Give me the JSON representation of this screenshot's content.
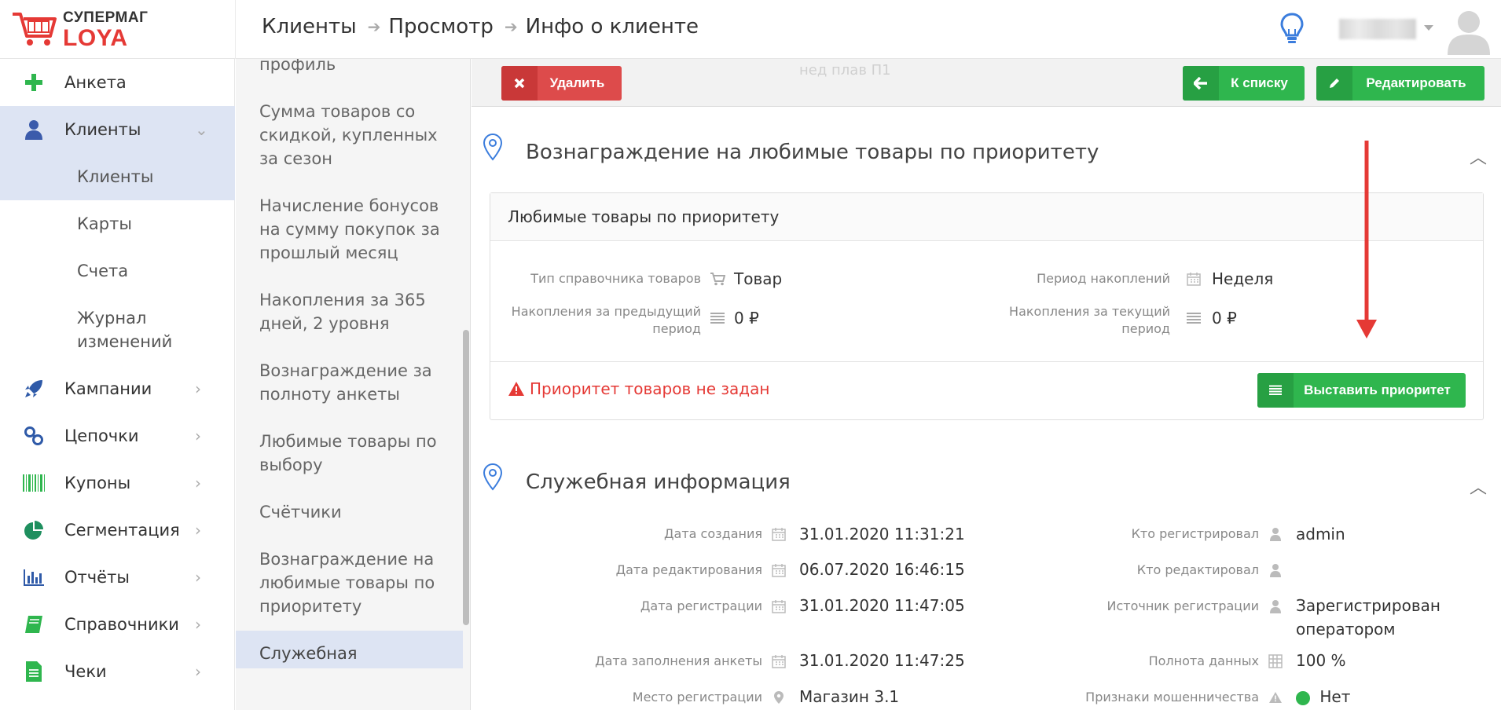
{
  "brand": {
    "top": "СУПЕРМАГ",
    "bottom": "LOYA"
  },
  "breadcrumb": [
    "Клиенты",
    "Просмотр",
    "Инфо о клиенте"
  ],
  "sidebar": {
    "items": [
      {
        "label": "Анкета",
        "icon": "plus-icon"
      },
      {
        "label": "Клиенты",
        "icon": "user-icon"
      },
      {
        "label": "Кампании",
        "icon": "rocket-icon"
      },
      {
        "label": "Цепочки",
        "icon": "chain-icon"
      },
      {
        "label": "Купоны",
        "icon": "barcode-icon"
      },
      {
        "label": "Сегментация",
        "icon": "pie-chart-icon"
      },
      {
        "label": "Отчёты",
        "icon": "bar-chart-icon"
      },
      {
        "label": "Справочники",
        "icon": "book-icon"
      },
      {
        "label": "Чеки",
        "icon": "receipt-icon"
      }
    ],
    "sub": [
      "Клиенты",
      "Карты",
      "Счета",
      "Журнал изменений"
    ]
  },
  "secnav": [
    "профиль",
    "Сумма товаров со скидкой, купленных за сезон",
    "Начисление бонусов на сумму покупок за прошлый месяц",
    "Накопления за 365 дней, 2 уровня",
    "Вознаграждение за полноту анкеты",
    "Любимые товары по выбору",
    "Счётчики",
    "Вознаграждение на любимые товары по приоритету",
    "Служебная"
  ],
  "actions": {
    "delete": "Удалить",
    "to_list": "К списку",
    "edit": "Редактировать",
    "ghost": "нед плав П1"
  },
  "section1": {
    "title": "Вознаграждение на любимые товары по приоритету",
    "panel_title": "Любимые товары по приоритету",
    "fields": {
      "ref_type_label": "Тип справочника товаров",
      "ref_type_value": "Товар",
      "period_label": "Период накоплений",
      "period_value": "Неделя",
      "prev_label": "Накопления за предыдущий период",
      "prev_value": "0 ₽",
      "cur_label": "Накопления за текущий период",
      "cur_value": "0 ₽"
    },
    "warning": "Приоритет товаров не задан",
    "set_priority": "Выставить приоритет"
  },
  "section2": {
    "title": "Служебная информация",
    "created_label": "Дата создания",
    "created_value": "31.01.2020 11:31:21",
    "edited_label": "Дата редактирования",
    "edited_value": "06.07.2020 16:46:15",
    "registered_label": "Дата регистрации",
    "registered_value": "31.01.2020 11:47:05",
    "filled_label": "Дата заполнения анкеты",
    "filled_value": "31.01.2020 11:47:25",
    "place_label": "Место регистрации",
    "place_value": "Магазин 3.1",
    "who_reg_label": "Кто регистрировал",
    "who_reg_value": "admin",
    "who_edit_label": "Кто редактировал",
    "who_edit_value": "",
    "source_label": "Источник регистрации",
    "source_value": "Зарегистрирован оператором",
    "completeness_label": "Полнота данных",
    "completeness_value": "100 %",
    "fraud_label": "Признаки мошенничества",
    "fraud_value": "Нет"
  },
  "colors": {
    "accent_green": "#2fb64e",
    "accent_red": "#dd4b4b",
    "active_bg": "#dde4f3",
    "warn_red": "#e53935"
  }
}
